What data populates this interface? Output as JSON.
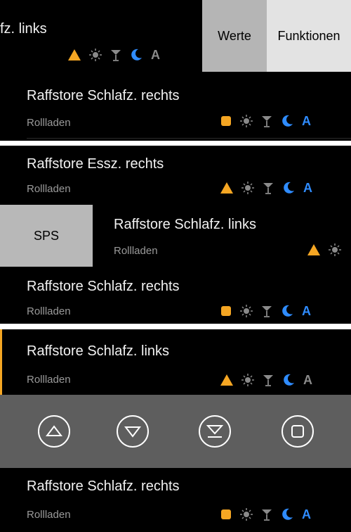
{
  "colors": {
    "accent_blue": "#2f8cff",
    "warning_orange": "#f5a623",
    "inactive_gray": "#8a8a8a",
    "panel_gray": "#5e5e5e"
  },
  "panel1": {
    "row_title_partial": "fz. links",
    "swipe_actions": {
      "values_label": "Werte",
      "functions_label": "Funktionen"
    },
    "second_row": {
      "title": "Raffstore Schlafz. rechts",
      "subtitle": "Rollladen"
    }
  },
  "panel2": {
    "rows": [
      {
        "title": "Raffstore Essz. rechts",
        "subtitle": "Rollladen"
      },
      {
        "title": "Raffstore Schlafz. links",
        "subtitle": "Rollladen"
      },
      {
        "title": "Raffstore Schlafz. rechts",
        "subtitle": "Rollladen"
      }
    ],
    "swipe_action": {
      "sps_label": "SPS"
    }
  },
  "panel3": {
    "rows": [
      {
        "title": "Raffstore Schlafz. links",
        "subtitle": "Rollladen"
      },
      {
        "title": "Raffstore Schlafz. rechts",
        "subtitle": "Rollladen"
      }
    ],
    "controls": [
      {
        "icon": "arrow-up-icon"
      },
      {
        "icon": "arrow-down-icon"
      },
      {
        "icon": "arrow-down-stop-icon"
      },
      {
        "icon": "stop-square-icon"
      }
    ]
  },
  "status_icons": {
    "names": [
      "warning-triangle-icon",
      "sun-icon",
      "cocktail-icon",
      "moon-icon",
      "automatic-a-icon"
    ],
    "auto_letter": "A"
  }
}
